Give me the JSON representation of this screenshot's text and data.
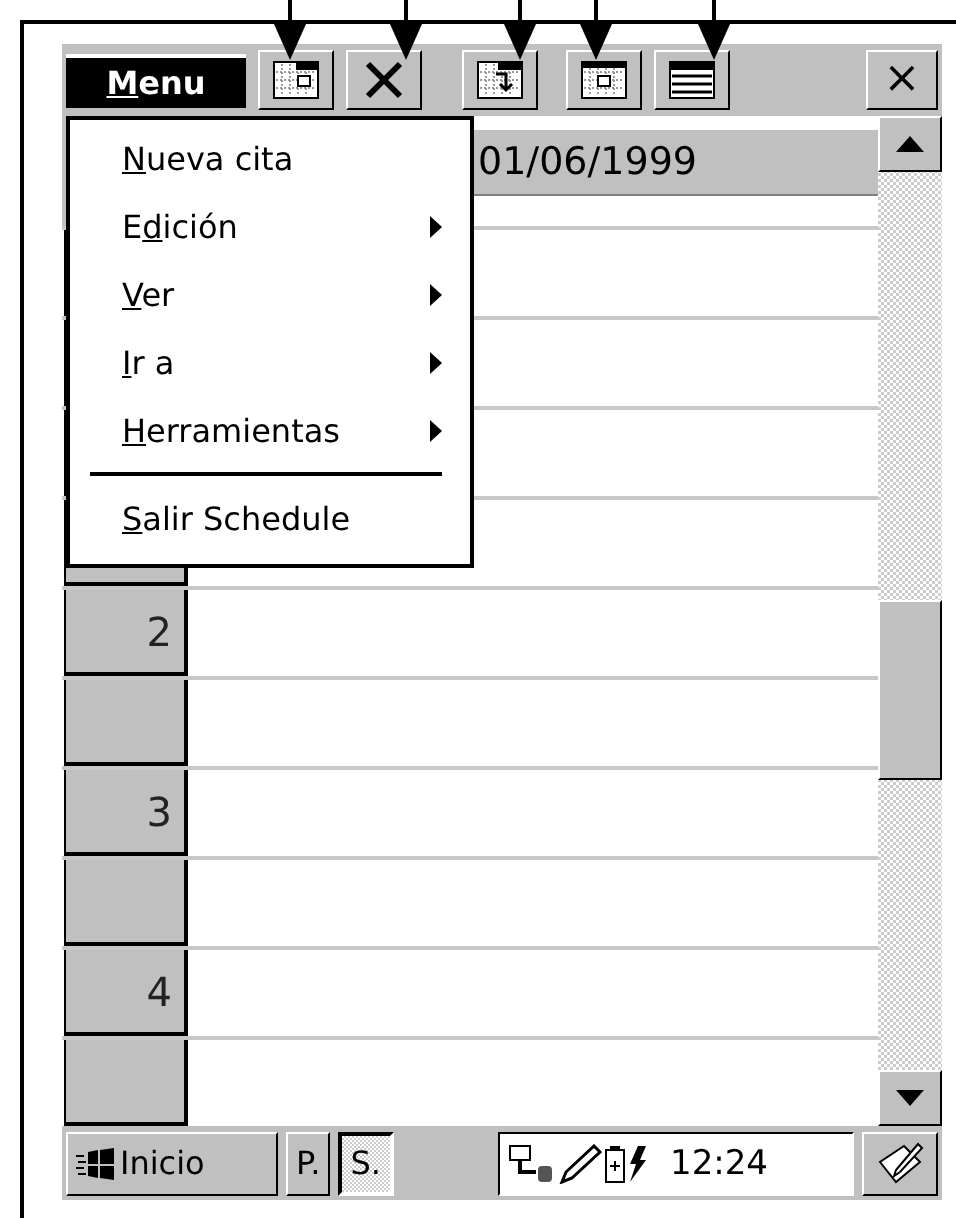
{
  "toolbar": {
    "menu_button": {
      "key": "M",
      "after": "enu"
    },
    "tools": [
      {
        "kind": "calendar-day"
      },
      {
        "kind": "delete"
      },
      {
        "kind": "calendar-jump"
      },
      {
        "kind": "calendar-week"
      },
      {
        "kind": "calendar-month"
      }
    ],
    "close": "×"
  },
  "menu": {
    "items": [
      {
        "kind": "command",
        "key": "N",
        "after": "ueva cita"
      },
      {
        "kind": "submenu",
        "before": "E",
        "key": "d",
        "after": "ición"
      },
      {
        "kind": "submenu",
        "key": "V",
        "after": "er"
      },
      {
        "kind": "submenu",
        "key": "I",
        "after": "r a"
      },
      {
        "kind": "submenu",
        "key": "H",
        "after": "erramientas"
      },
      {
        "kind": "separator"
      },
      {
        "kind": "command",
        "key": "S",
        "after": "alir Schedule"
      }
    ]
  },
  "date": "01/06/1999",
  "hour_labels": [
    "2",
    "3",
    "4"
  ],
  "taskbar": {
    "start": "Inicio",
    "tasks": [
      {
        "label": "P.",
        "selected": false
      },
      {
        "label": "S.",
        "selected": true
      }
    ],
    "time": "12:24"
  }
}
